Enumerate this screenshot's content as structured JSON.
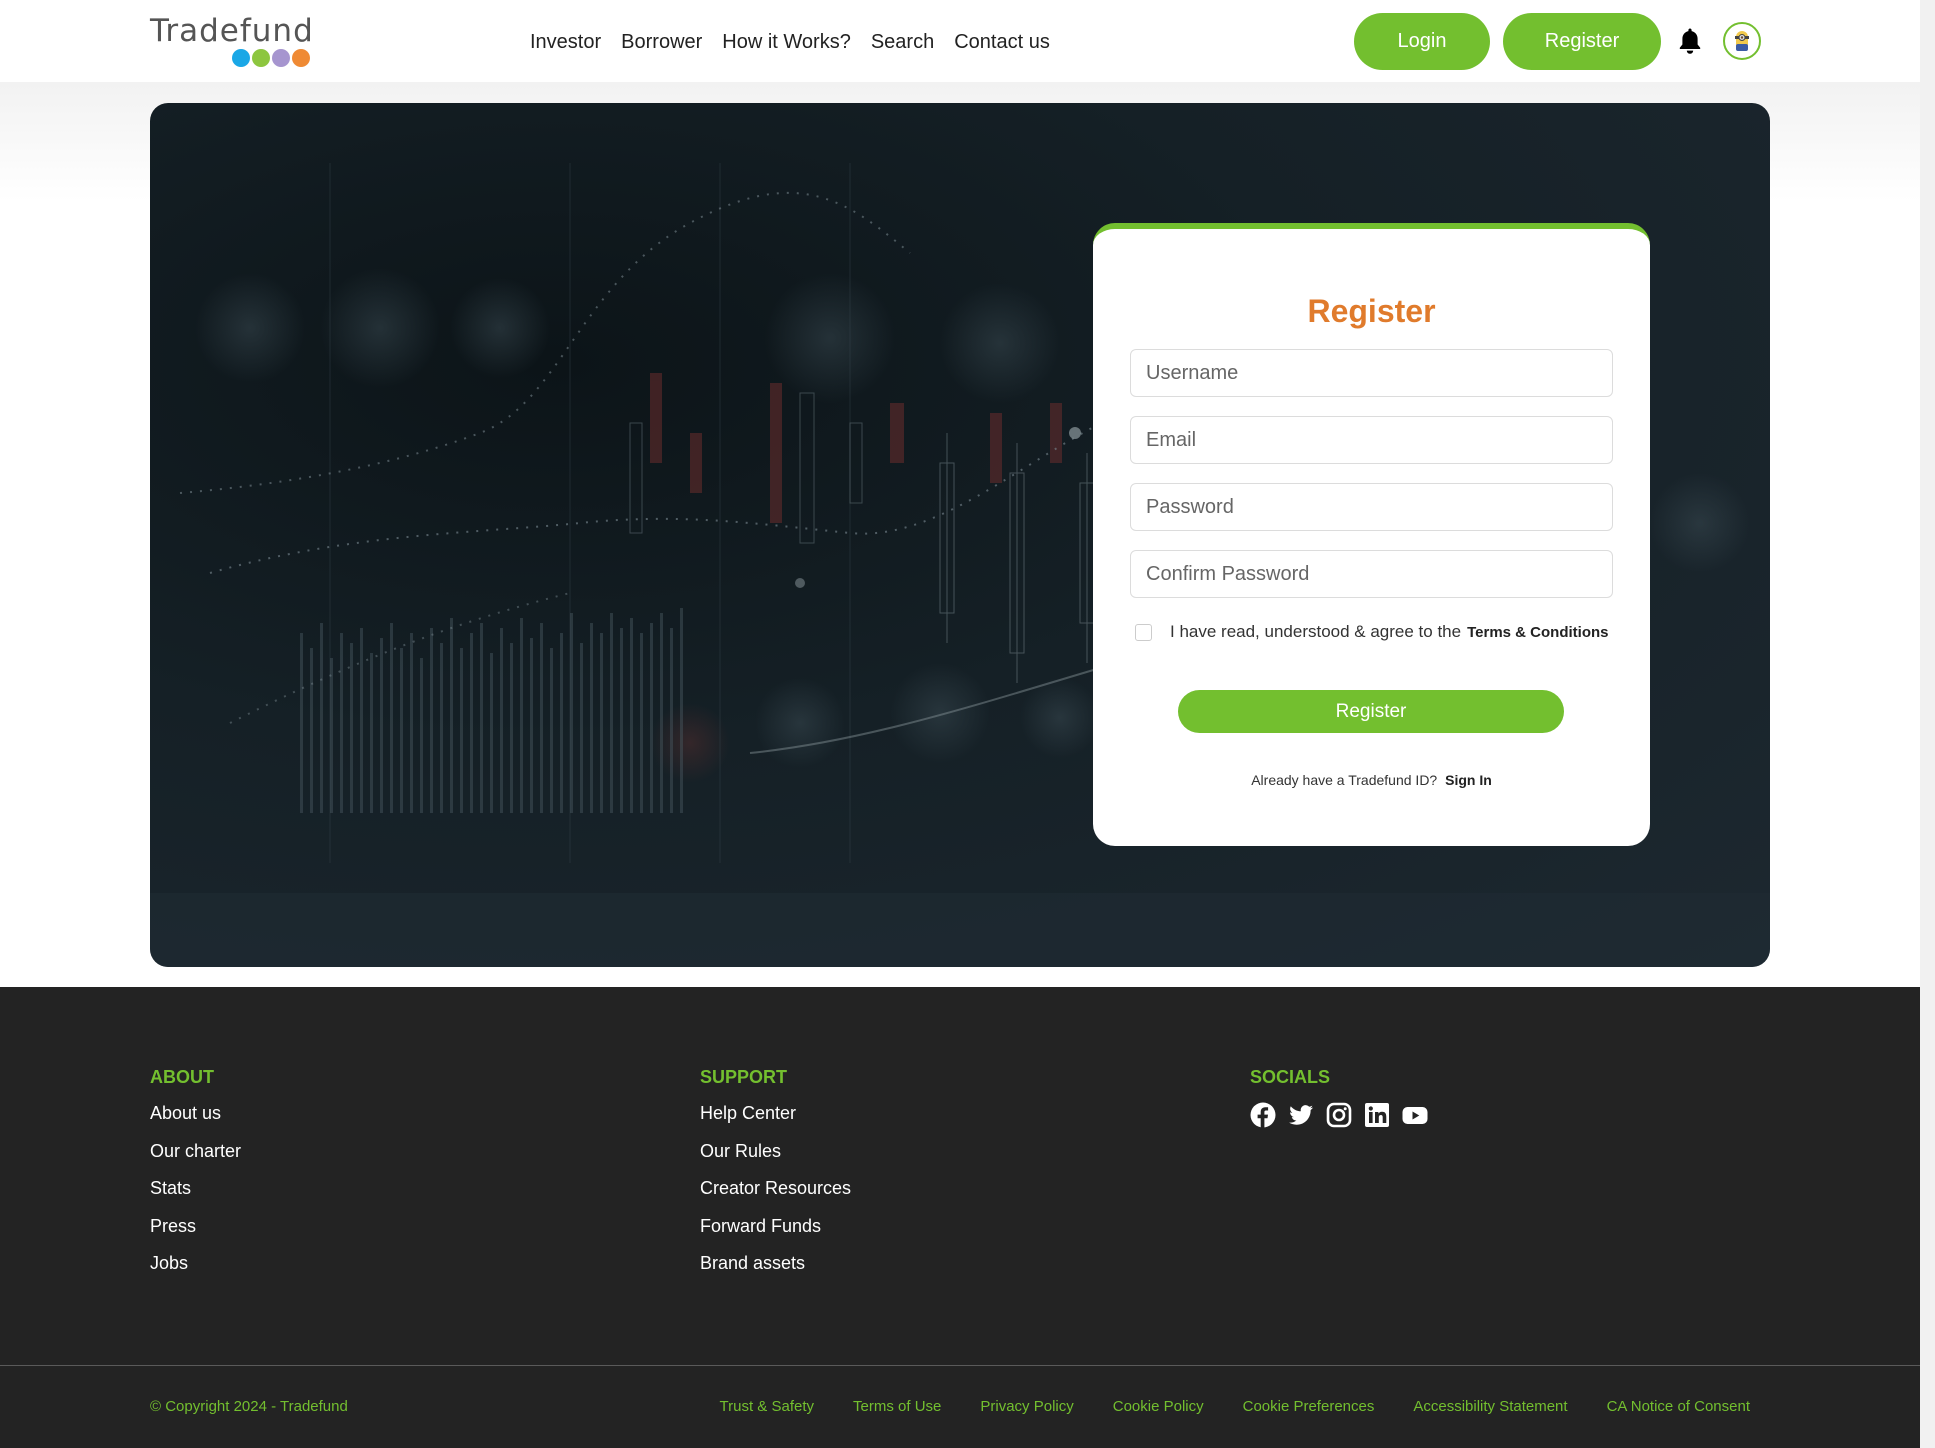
{
  "header": {
    "logo_text": "Tradefund",
    "logo_dot_colors": [
      "#1aa7e6",
      "#8dc63f",
      "#a695cf",
      "#ef8a34"
    ],
    "nav": [
      "Investor",
      "Borrower",
      "How it Works?",
      "Search",
      "Contact us"
    ],
    "login_label": "Login",
    "register_label": "Register",
    "notification_icon": "bell-icon",
    "avatar_icon": "user-avatar-icon"
  },
  "register_form": {
    "title": "Register",
    "fields": [
      {
        "placeholder": "Username",
        "value": ""
      },
      {
        "placeholder": "Email",
        "value": ""
      },
      {
        "placeholder": "Password",
        "value": ""
      },
      {
        "placeholder": "Confirm Password",
        "value": ""
      }
    ],
    "terms_checked": false,
    "terms_text": "I have read, understood & agree to the",
    "terms_link": "Terms & Conditions",
    "submit_label": "Register",
    "signin_prompt": "Already have a Tradefund ID?",
    "signin_link": "Sign In"
  },
  "footer": {
    "about": {
      "heading": "ABOUT",
      "links": [
        "About us",
        "Our charter",
        "Stats",
        "Press",
        "Jobs"
      ]
    },
    "support": {
      "heading": "SUPPORT",
      "links": [
        "Help Center",
        "Our Rules",
        "Creator Resources",
        "Forward Funds",
        "Brand assets"
      ]
    },
    "socials": {
      "heading": "SOCIALS",
      "icons": [
        "facebook-icon",
        "twitter-icon",
        "instagram-icon",
        "linkedin-icon",
        "youtube-icon"
      ]
    },
    "copyright": "© Copyright 2024 - Tradefund",
    "legal_links": [
      "Trust & Safety",
      "Terms of Use",
      "Privacy Policy",
      "Cookie Policy",
      "Cookie Preferences",
      "Accessibility Statement",
      "CA Notice of Consent"
    ]
  },
  "colors": {
    "accent_green": "#73bf2f",
    "title_orange": "#e07b2c",
    "footer_bg": "#232323",
    "hero_bg": "#162127"
  }
}
